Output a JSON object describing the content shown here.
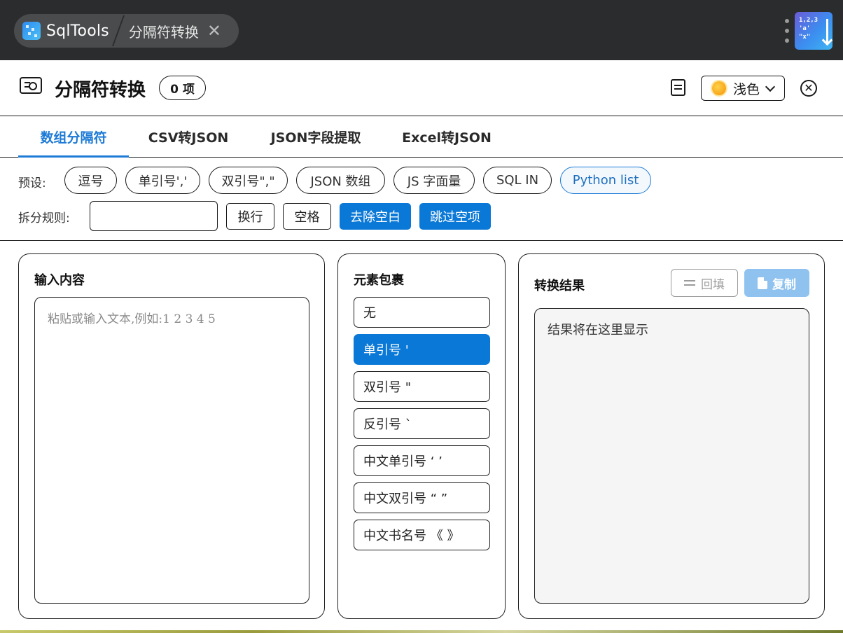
{
  "titlebar": {
    "app_name": "SqlTools",
    "tab_label": "分隔符转换",
    "tab_close": "✕",
    "logo_lines": [
      "1,2,3",
      "'a'",
      "\"x\""
    ]
  },
  "header": {
    "title": "分隔符转换",
    "count": "0 项",
    "theme_label": "浅色",
    "close_glyph": "✕"
  },
  "tabs": [
    {
      "label": "数组分隔符",
      "active": true
    },
    {
      "label": "CSV转JSON",
      "active": false
    },
    {
      "label": "JSON字段提取",
      "active": false
    },
    {
      "label": "Excel转JSON",
      "active": false
    }
  ],
  "presets": {
    "label": "预设:",
    "items": [
      {
        "label": "逗号"
      },
      {
        "label": "单引号','"
      },
      {
        "label": "双引号\",\""
      },
      {
        "label": "JSON 数组"
      },
      {
        "label": "JS 字面量"
      },
      {
        "label": "SQL IN"
      },
      {
        "label": "Python list",
        "active": true
      }
    ]
  },
  "split": {
    "label": "拆分规则:",
    "input_value": "",
    "buttons": [
      {
        "label": "换行",
        "on": false
      },
      {
        "label": "空格",
        "on": false
      },
      {
        "label": "去除空白",
        "on": true
      },
      {
        "label": "跳过空项",
        "on": true
      }
    ]
  },
  "input_panel": {
    "title": "输入内容",
    "placeholder": "粘贴或输入文本,例如:1 2 3 4 5"
  },
  "wrap_panel": {
    "title": "元素包裹",
    "options": [
      {
        "label": "无",
        "on": false
      },
      {
        "label": "单引号 '",
        "on": true
      },
      {
        "label": "双引号 \"",
        "on": false
      },
      {
        "label": "反引号 `",
        "on": false
      },
      {
        "label": "中文单引号 ‘ ’",
        "on": false
      },
      {
        "label": "中文双引号 “ ”",
        "on": false
      },
      {
        "label": "中文书名号 《 》",
        "on": false
      }
    ]
  },
  "result_panel": {
    "title": "转换结果",
    "refill_label": "回填",
    "copy_label": "复制",
    "placeholder": "结果将在这里显示"
  },
  "colors": {
    "accent": "#0a78d6",
    "tab_active": "#1e7bd6",
    "copy_disabled": "#8fc2ee",
    "titlebar": "#2b2c2e"
  },
  "icons": {
    "app": "database-icon",
    "header": "id-card-icon",
    "doc": "document-icon",
    "theme": "sun-icon",
    "close": "close-circle-icon",
    "refill": "swap-icon",
    "copy": "copy-icon"
  }
}
